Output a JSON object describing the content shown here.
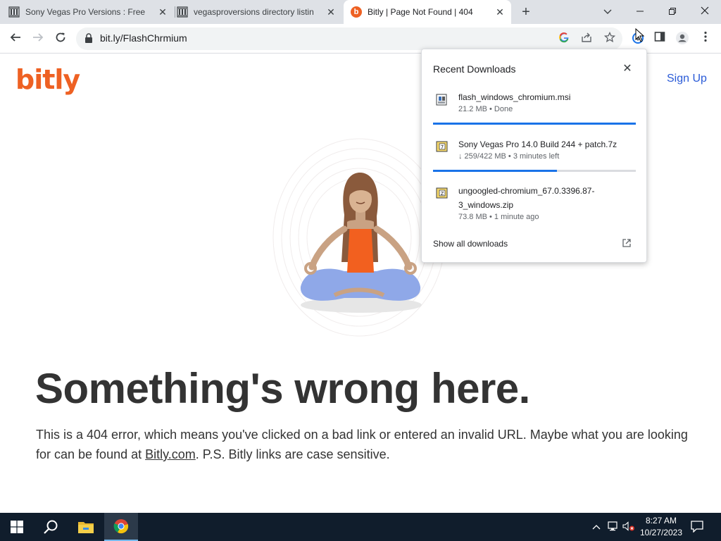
{
  "tabs": [
    {
      "title": "Sony Vegas Pro Versions : Free D",
      "favicon": "government-building-icon"
    },
    {
      "title": "vegasproversions directory listing",
      "favicon": "government-building-icon"
    },
    {
      "title": "Bitly | Page Not Found | 404",
      "favicon": "bitly-icon",
      "active": true
    }
  ],
  "toolbar": {
    "url": "bit.ly/FlashChrmium"
  },
  "page": {
    "logo": "bitly",
    "signup": "Sign Up",
    "headline": "Something's wrong here.",
    "desc_before": "This is a 404 error, which means you've clicked on a bad link or entered an invalid URL. Maybe what you are looking for can be found at ",
    "desc_link": "Bitly.com",
    "desc_after": ". P.S. Bitly links are case sensitive."
  },
  "downloads": {
    "title": "Recent Downloads",
    "items": [
      {
        "name": "flash_windows_chromium.msi",
        "status": "21.2 MB • Done",
        "progress": 1.0
      },
      {
        "name": "Sony Vegas Pro 14.0 Build 244 + patch.7z",
        "status": "↓ 259/422 MB • 3 minutes left",
        "progress": 0.61
      },
      {
        "name": "ungoogled-chromium_67.0.3396.87-3_windows.zip",
        "status": "73.8 MB • 1 minute ago"
      }
    ],
    "show_all": "Show all downloads"
  },
  "taskbar": {
    "time": "8:27 AM",
    "date": "10/27/2023"
  },
  "colors": {
    "brand": "#ee6123",
    "link_blue": "#2a5bd7",
    "progress_blue": "#1a73e8",
    "taskbar": "#101d2c"
  }
}
